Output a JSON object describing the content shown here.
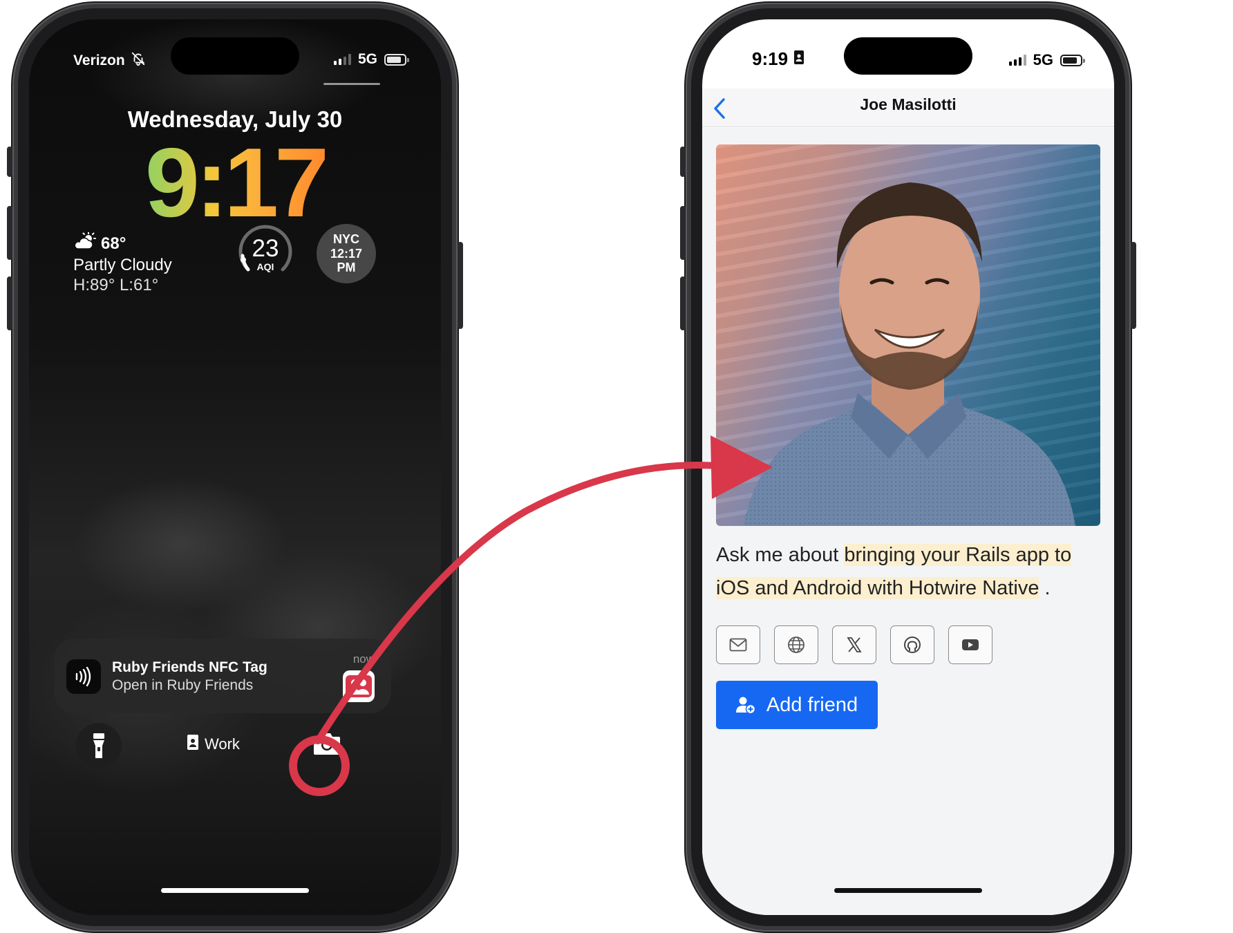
{
  "left_phone": {
    "status": {
      "carrier": "Verizon",
      "network": "5G"
    },
    "date": "Wednesday, July 30",
    "time": "9:17",
    "weather": {
      "temp": "68°",
      "condition": "Partly Cloudy",
      "high_low": "H:89° L:61°"
    },
    "aqi": {
      "value": "23",
      "label": "AQI"
    },
    "world_clock": {
      "city": "NYC",
      "time": "12:17",
      "period": "PM"
    },
    "notification": {
      "title": "Ruby Friends NFC Tag",
      "subtitle": "Open in Ruby Friends",
      "time": "now"
    },
    "focus_label": "Work"
  },
  "right_phone": {
    "status": {
      "time": "9:19",
      "network": "5G"
    },
    "nav_title": "Joe Masilotti",
    "bio": {
      "prefix": "Ask me about ",
      "highlight": "bringing your Rails app to iOS and Android with Hotwire Native",
      "suffix": "."
    },
    "social_icons": [
      "email-icon",
      "globe-icon",
      "x-icon",
      "github-icon",
      "youtube-icon"
    ],
    "add_friend_label": "Add friend"
  },
  "colors": {
    "accent_blue": "#1668f2",
    "arrow_red": "#d9374a",
    "highlight": "#fcefcf"
  }
}
